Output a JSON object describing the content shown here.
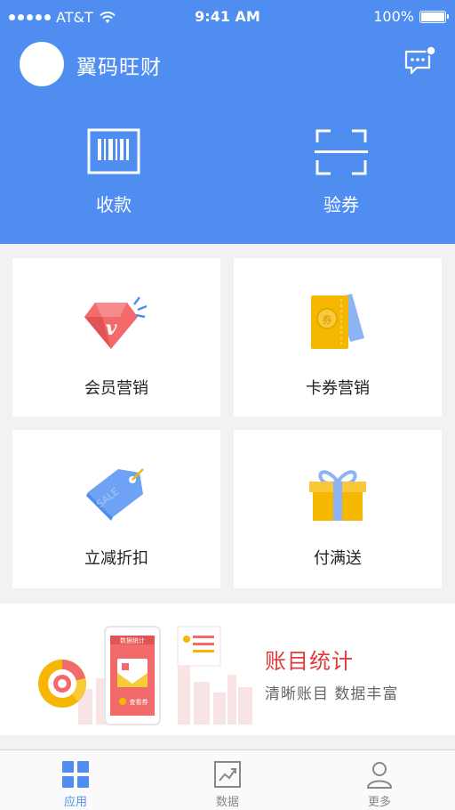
{
  "status_bar": {
    "carrier": "AT&T",
    "time": "9:41 AM",
    "battery": "100%"
  },
  "header": {
    "app_title": "翼码旺财",
    "actions": [
      {
        "label": "收款",
        "icon": "barcode-icon"
      },
      {
        "label": "验券",
        "icon": "scan-icon"
      }
    ]
  },
  "cards": [
    {
      "label": "会员营销",
      "icon": "diamond-icon"
    },
    {
      "label": "卡券营销",
      "icon": "coupon-icon"
    },
    {
      "label": "立减折扣",
      "icon": "sale-tag-icon"
    },
    {
      "label": "付满送",
      "icon": "gift-icon"
    }
  ],
  "banner": {
    "title": "账目统计",
    "subtitle": "清晰账目  数据丰富",
    "phone_header": "数据统计",
    "phone_caption": "查看券"
  },
  "tabbar": {
    "tabs": [
      {
        "label": "应用",
        "icon": "grid-icon",
        "active": true
      },
      {
        "label": "数据",
        "icon": "chart-icon",
        "active": false
      },
      {
        "label": "更多",
        "icon": "person-icon",
        "active": false
      }
    ]
  },
  "colors": {
    "primary": "#4f8ef0",
    "banner_title": "#e03a3a",
    "background": "#f2f2f4"
  }
}
